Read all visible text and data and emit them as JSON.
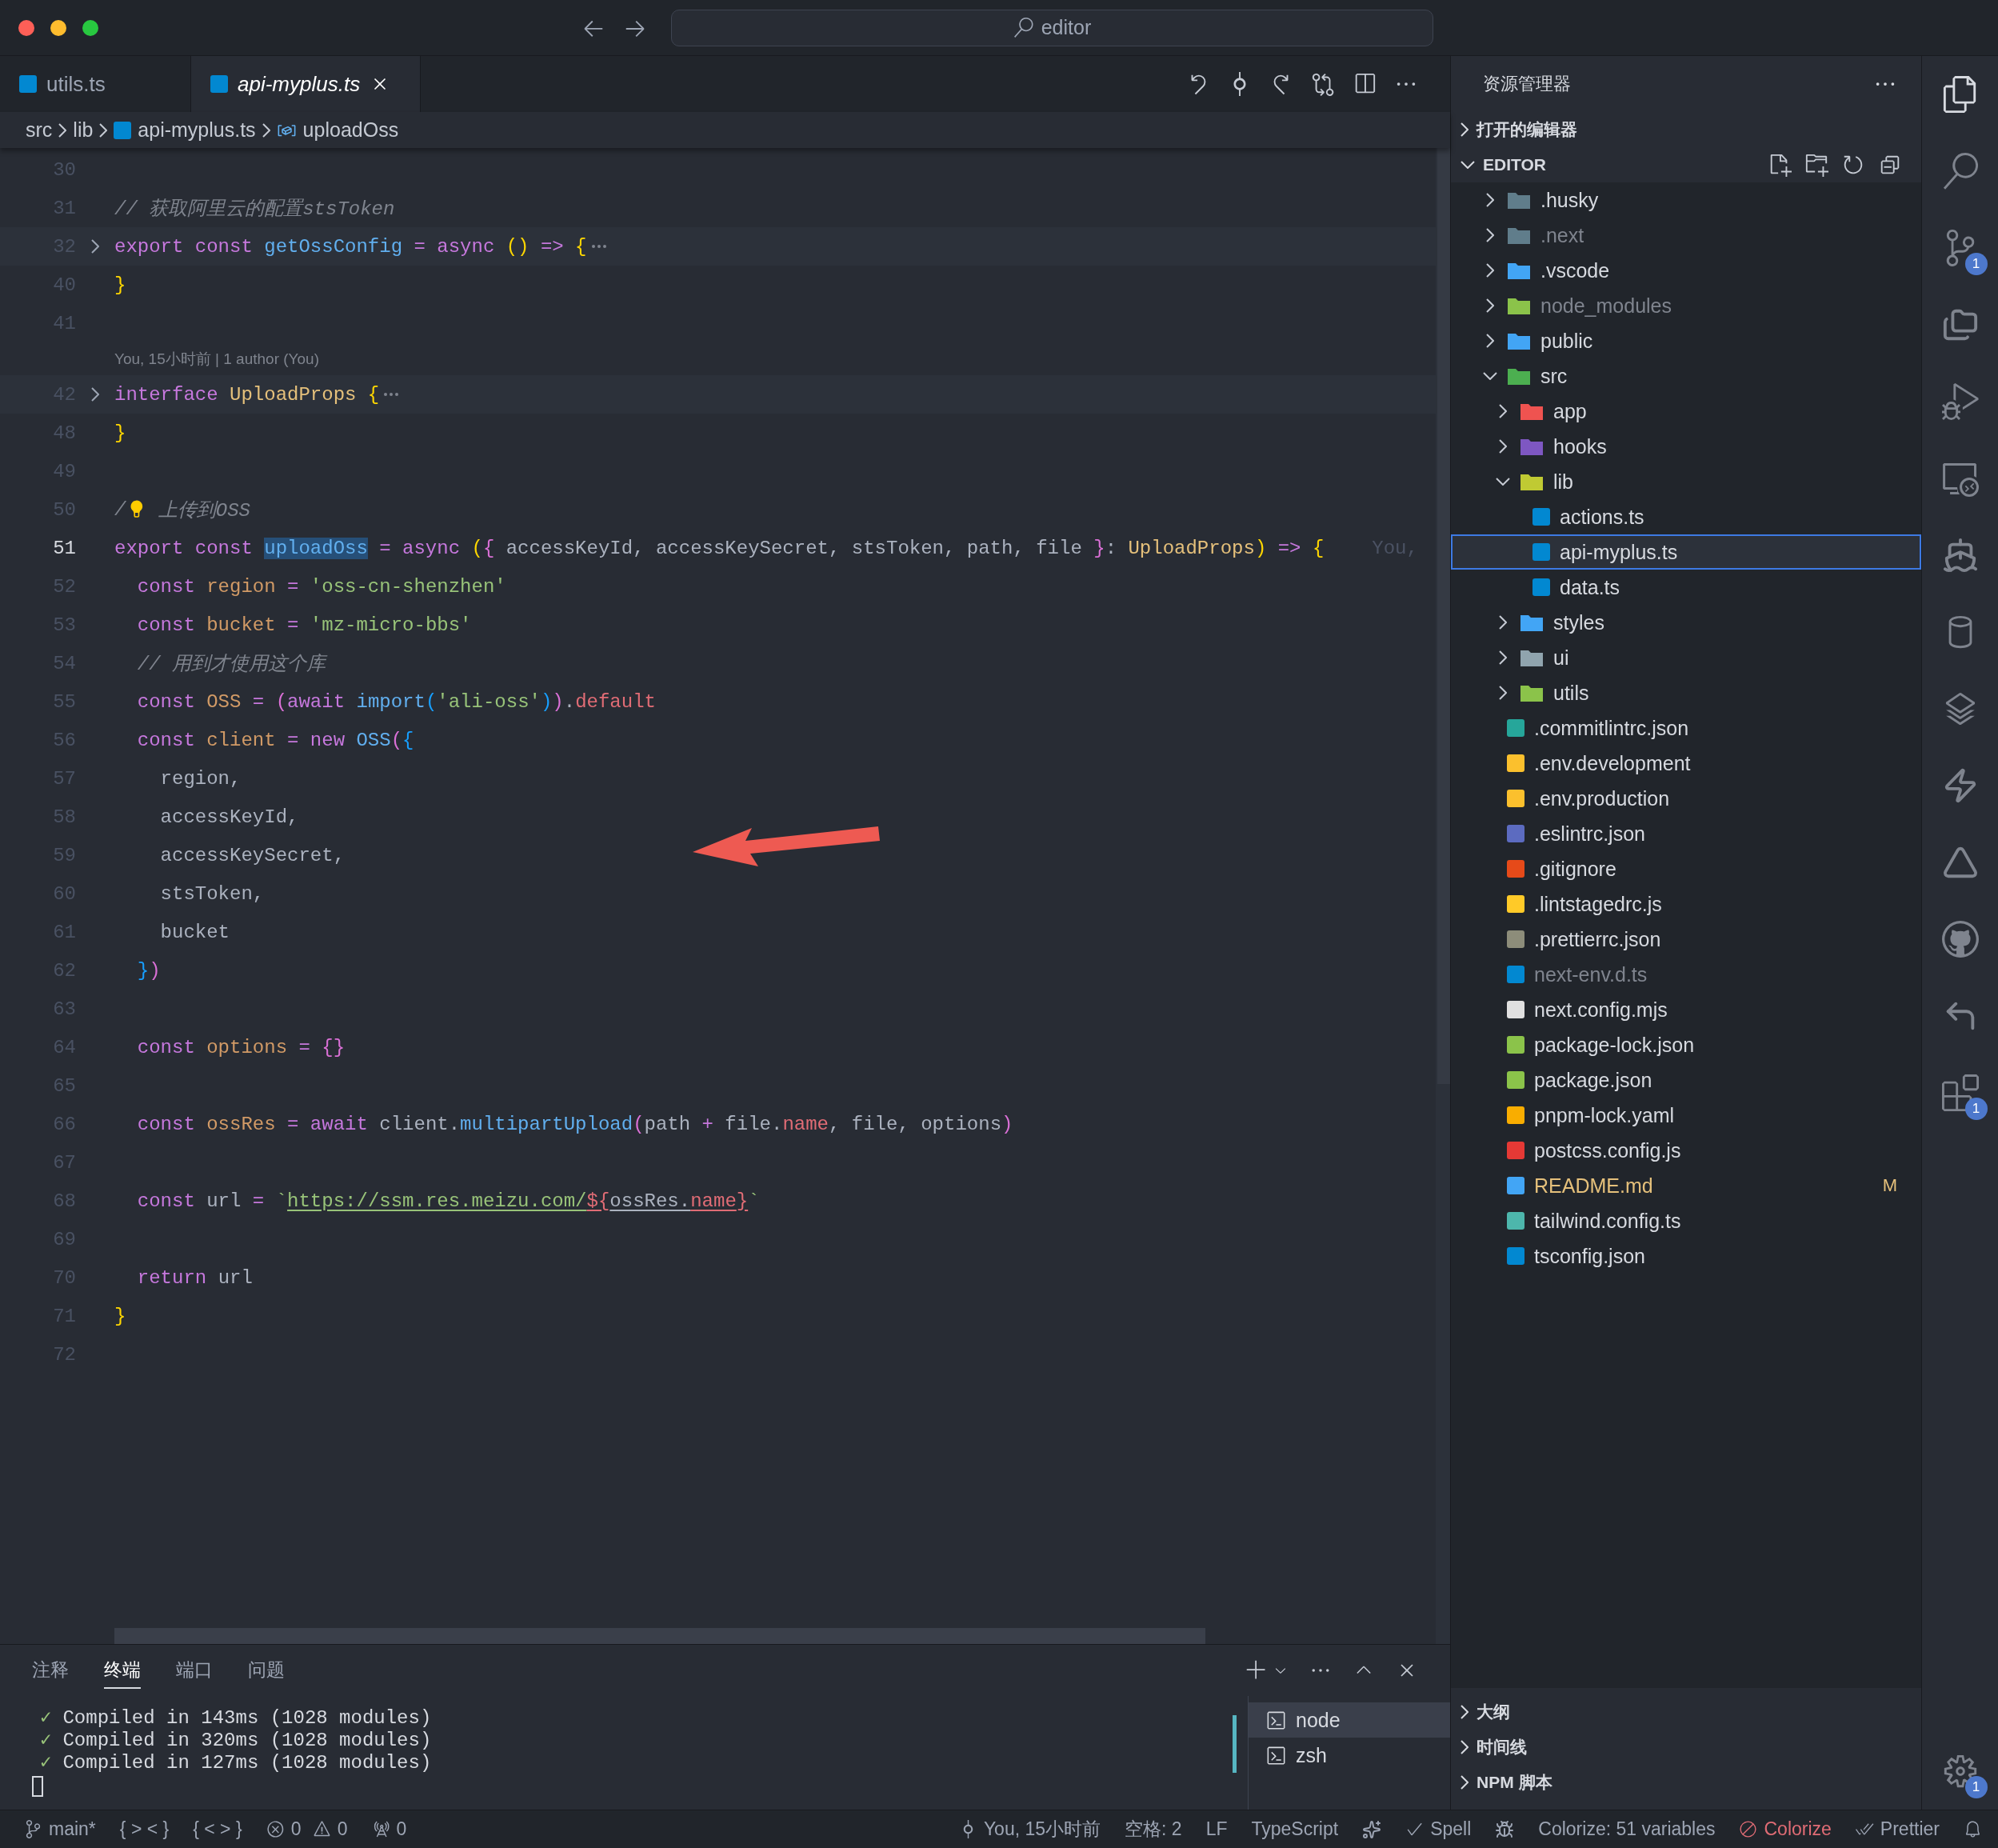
{
  "title_bar": {
    "search": "editor"
  },
  "tabs": [
    {
      "label": "utils.ts",
      "selected": false,
      "preview": false
    },
    {
      "label": "api-myplus.ts",
      "selected": true,
      "preview": true
    }
  ],
  "breadcrumbs": [
    {
      "label": "src",
      "kind": "folder"
    },
    {
      "label": "lib",
      "kind": "folder"
    },
    {
      "label": "api-myplus.ts",
      "kind": "file"
    },
    {
      "label": "uploadOss",
      "kind": "symbol"
    }
  ],
  "editor": {
    "lines": [
      {
        "kind": "code",
        "number": "30",
        "current": false,
        "folded": false
      },
      {
        "kind": "code",
        "number": "31",
        "current": false,
        "folded": false,
        "tokens": [
          {
            "text": "// 获取阿里云的配置stsToken",
            "kind": "comment"
          }
        ]
      },
      {
        "kind": "code",
        "number": "32",
        "current": false,
        "folded": true,
        "tokens": [
          {
            "text": "export const ",
            "kind": "keyword"
          },
          {
            "text": "getOssConfig",
            "kind": "function"
          },
          {
            "text": " = async ",
            "kind": "keyword"
          },
          {
            "text": "()",
            "kind": "bracket1"
          },
          {
            "text": " => ",
            "kind": "keyword"
          },
          {
            "text": "{",
            "kind": "bracket1"
          }
        ]
      },
      {
        "kind": "code",
        "number": "40",
        "current": false,
        "folded": false,
        "tokens": [
          {
            "text": "}",
            "kind": "bracket1"
          }
        ]
      },
      {
        "kind": "code",
        "number": "41",
        "current": false,
        "folded": false
      },
      {
        "kind": "codelens",
        "text": "You, 15小时前 | 1 author (You)"
      },
      {
        "kind": "code",
        "number": "42",
        "current": false,
        "folded": true,
        "tokens": [
          {
            "text": "interface ",
            "kind": "keyword"
          },
          {
            "text": "UploadProps ",
            "kind": "type"
          },
          {
            "text": "{",
            "kind": "bracket1"
          }
        ]
      },
      {
        "kind": "code",
        "number": "48",
        "current": false,
        "folded": false,
        "tokens": [
          {
            "text": "}",
            "kind": "bracket1"
          }
        ]
      },
      {
        "kind": "code",
        "number": "49",
        "current": false,
        "folded": false
      },
      {
        "kind": "code",
        "number": "50",
        "current": false,
        "folded": false,
        "tokens": [
          {
            "text": "/",
            "kind": "comment"
          },
          {
            "kind": "lightbulb"
          },
          {
            "text": " 上传到OSS",
            "kind": "comment"
          }
        ]
      },
      {
        "kind": "code",
        "number": "51",
        "current": true,
        "folded": false,
        "ghost": "You,",
        "tokens": [
          {
            "text": "export const ",
            "kind": "keyword"
          },
          {
            "text": "uploadOss",
            "kind": "function",
            "highlight": true
          },
          {
            "text": " = async ",
            "kind": "keyword"
          },
          {
            "text": "(",
            "kind": "bracket1"
          },
          {
            "text": "{",
            "kind": "bracket2"
          },
          {
            "text": " accessKeyId, accessKeySecret, stsToken, path, file ",
            "kind": "text"
          },
          {
            "text": "}",
            "kind": "bracket2"
          },
          {
            "text": ": ",
            "kind": "text"
          },
          {
            "text": "UploadProps",
            "kind": "type"
          },
          {
            "text": ")",
            "kind": "bracket1"
          },
          {
            "text": " => ",
            "kind": "keyword"
          },
          {
            "text": "{",
            "kind": "bracket1"
          }
        ]
      },
      {
        "kind": "code",
        "number": "52",
        "current": false,
        "folded": false,
        "tokens": [
          {
            "text": "  const ",
            "kind": "keyword"
          },
          {
            "text": "region",
            "kind": "variable"
          },
          {
            "text": " = ",
            "kind": "keyword"
          },
          {
            "text": "'oss-cn-shenzhen'",
            "kind": "string"
          }
        ]
      },
      {
        "kind": "code",
        "number": "53",
        "current": false,
        "folded": false,
        "tokens": [
          {
            "text": "  const ",
            "kind": "keyword"
          },
          {
            "text": "bucket",
            "kind": "variable"
          },
          {
            "text": " = ",
            "kind": "keyword"
          },
          {
            "text": "'mz-micro-bbs'",
            "kind": "string"
          }
        ]
      },
      {
        "kind": "code",
        "number": "54",
        "current": false,
        "folded": false,
        "tokens": [
          {
            "text": "  // 用到才使用这个库",
            "kind": "comment"
          }
        ]
      },
      {
        "kind": "code",
        "number": "55",
        "current": false,
        "folded": false,
        "tokens": [
          {
            "text": "  const ",
            "kind": "keyword"
          },
          {
            "text": "OSS",
            "kind": "variable"
          },
          {
            "text": " = ",
            "kind": "keyword"
          },
          {
            "text": "(",
            "kind": "bracket2"
          },
          {
            "text": "await ",
            "kind": "keyword"
          },
          {
            "text": "import",
            "kind": "function"
          },
          {
            "text": "(",
            "kind": "bracket3"
          },
          {
            "text": "'ali-oss'",
            "kind": "string"
          },
          {
            "text": ")",
            "kind": "bracket3"
          },
          {
            "text": ")",
            "kind": "bracket2"
          },
          {
            "text": ".",
            "kind": "text"
          },
          {
            "text": "default",
            "kind": "property"
          }
        ]
      },
      {
        "kind": "code",
        "number": "56",
        "current": false,
        "folded": false,
        "tokens": [
          {
            "text": "  const ",
            "kind": "keyword"
          },
          {
            "text": "client",
            "kind": "variable"
          },
          {
            "text": " = new ",
            "kind": "keyword"
          },
          {
            "text": "OSS",
            "kind": "function"
          },
          {
            "text": "(",
            "kind": "bracket2"
          },
          {
            "text": "{",
            "kind": "bracket3"
          }
        ]
      },
      {
        "kind": "code",
        "number": "57",
        "current": false,
        "folded": false,
        "tokens": [
          {
            "text": "    region,",
            "kind": "text"
          }
        ]
      },
      {
        "kind": "code",
        "number": "58",
        "current": false,
        "folded": false,
        "tokens": [
          {
            "text": "    accessKeyId,",
            "kind": "text"
          }
        ]
      },
      {
        "kind": "code",
        "number": "59",
        "current": false,
        "folded": false,
        "tokens": [
          {
            "text": "    accessKeySecret,",
            "kind": "text"
          }
        ]
      },
      {
        "kind": "code",
        "number": "60",
        "current": false,
        "folded": false,
        "tokens": [
          {
            "text": "    stsToken,",
            "kind": "text"
          }
        ]
      },
      {
        "kind": "code",
        "number": "61",
        "current": false,
        "folded": false,
        "tokens": [
          {
            "text": "    bucket",
            "kind": "text"
          }
        ]
      },
      {
        "kind": "code",
        "number": "62",
        "current": false,
        "folded": false,
        "tokens": [
          {
            "text": "  }",
            "kind": "bracket3"
          },
          {
            "text": ")",
            "kind": "bracket2"
          }
        ]
      },
      {
        "kind": "code",
        "number": "63",
        "current": false,
        "folded": false
      },
      {
        "kind": "code",
        "number": "64",
        "current": false,
        "folded": false,
        "tokens": [
          {
            "text": "  const ",
            "kind": "keyword"
          },
          {
            "text": "options",
            "kind": "variable"
          },
          {
            "text": " = ",
            "kind": "keyword"
          },
          {
            "text": "{}",
            "kind": "bracket2"
          }
        ]
      },
      {
        "kind": "code",
        "number": "65",
        "current": false,
        "folded": false
      },
      {
        "kind": "code",
        "number": "66",
        "current": false,
        "folded": false,
        "tokens": [
          {
            "text": "  const ",
            "kind": "keyword"
          },
          {
            "text": "ossRes",
            "kind": "variable"
          },
          {
            "text": " = await ",
            "kind": "keyword"
          },
          {
            "text": "client.",
            "kind": "text"
          },
          {
            "text": "multipartUpload",
            "kind": "function"
          },
          {
            "text": "(",
            "kind": "bracket2"
          },
          {
            "text": "path ",
            "kind": "text"
          },
          {
            "text": "+",
            "kind": "keyword"
          },
          {
            "text": " file.",
            "kind": "text"
          },
          {
            "text": "name",
            "kind": "property"
          },
          {
            "text": ", file, options",
            "kind": "text"
          },
          {
            "text": ")",
            "kind": "bracket2"
          }
        ]
      },
      {
        "kind": "code",
        "number": "67",
        "current": false,
        "folded": false
      },
      {
        "kind": "code",
        "number": "68",
        "current": false,
        "folded": false,
        "tokens": [
          {
            "text": "  const ",
            "kind": "keyword"
          },
          {
            "text": "url",
            "kind": "text"
          },
          {
            "text": " = ",
            "kind": "keyword"
          },
          {
            "text": "`",
            "kind": "string"
          },
          {
            "text": "https://ssm.res.meizu.com/",
            "kind": "string",
            "link": true
          },
          {
            "text": "${",
            "kind": "property",
            "link": true
          },
          {
            "text": "ossRes.",
            "kind": "text",
            "link": true
          },
          {
            "text": "name",
            "kind": "property",
            "link": true
          },
          {
            "text": "}",
            "kind": "property",
            "link": true
          },
          {
            "text": "`",
            "kind": "string"
          }
        ]
      },
      {
        "kind": "code",
        "number": "69",
        "current": false,
        "folded": false
      },
      {
        "kind": "code",
        "number": "70",
        "current": false,
        "folded": false,
        "tokens": [
          {
            "text": "  return ",
            "kind": "keyword"
          },
          {
            "text": "url",
            "kind": "text"
          }
        ]
      },
      {
        "kind": "code",
        "number": "71",
        "current": false,
        "folded": false,
        "tokens": [
          {
            "text": "}",
            "kind": "bracket1"
          }
        ]
      },
      {
        "kind": "code",
        "number": "72",
        "current": false,
        "folded": false
      }
    ]
  },
  "panel": {
    "tabs": [
      {
        "label": "注释",
        "selected": false
      },
      {
        "label": "终端",
        "selected": true
      },
      {
        "label": "端口",
        "selected": false
      },
      {
        "label": "问题",
        "selected": false
      }
    ],
    "output": [
      {
        "mark": "✓",
        "text": "Compiled in 143ms (1028 modules)"
      },
      {
        "mark": "✓",
        "text": "Compiled in 320ms (1028 modules)"
      },
      {
        "mark": "✓",
        "text": "Compiled in 127ms (1028 modules)"
      }
    ],
    "terminals": [
      {
        "label": "node",
        "selected": true
      },
      {
        "label": "zsh",
        "selected": false
      }
    ]
  },
  "sidebar": {
    "title": "资源管理器",
    "sections_top": [
      {
        "label": "打开的编辑器",
        "expanded": false
      },
      {
        "label": "EDITOR",
        "expanded": true
      }
    ],
    "tree": [
      {
        "name": ".husky",
        "kind": "folder",
        "expanded": false,
        "selected": false,
        "dimmed": false,
        "modified": false,
        "color": "#607d8b"
      },
      {
        "name": ".next",
        "kind": "folder",
        "expanded": false,
        "selected": false,
        "dimmed": true,
        "modified": false,
        "color": "#607d8b"
      },
      {
        "name": ".vscode",
        "kind": "folder",
        "expanded": false,
        "selected": false,
        "dimmed": false,
        "modified": false,
        "color": "#42a5f5"
      },
      {
        "name": "node_modules",
        "kind": "folder",
        "expanded": false,
        "selected": false,
        "dimmed": true,
        "modified": false,
        "color": "#8bc34a"
      },
      {
        "name": "public",
        "kind": "folder",
        "expanded": false,
        "selected": false,
        "dimmed": false,
        "modified": false,
        "color": "#42a5f5"
      },
      {
        "name": "src",
        "kind": "folder",
        "expanded": true,
        "selected": false,
        "dimmed": false,
        "modified": false,
        "color": "#4caf50",
        "children": [
          {
            "name": "app",
            "kind": "folder",
            "expanded": false,
            "selected": false,
            "dimmed": false,
            "modified": false,
            "color": "#ef5350"
          },
          {
            "name": "hooks",
            "kind": "folder",
            "expanded": false,
            "selected": false,
            "dimmed": false,
            "modified": false,
            "color": "#7e57c2"
          },
          {
            "name": "lib",
            "kind": "folder",
            "expanded": true,
            "selected": false,
            "dimmed": false,
            "modified": false,
            "color": "#c0ca33",
            "children": [
              {
                "name": "actions.ts",
                "kind": "file",
                "selected": false,
                "dimmed": false,
                "modified": false,
                "color": "#0288d1"
              },
              {
                "name": "api-myplus.ts",
                "kind": "file",
                "selected": true,
                "dimmed": false,
                "modified": false,
                "color": "#0288d1"
              },
              {
                "name": "data.ts",
                "kind": "file",
                "selected": false,
                "dimmed": false,
                "modified": false,
                "color": "#0288d1"
              }
            ]
          },
          {
            "name": "styles",
            "kind": "folder",
            "expanded": false,
            "selected": false,
            "dimmed": false,
            "modified": false,
            "color": "#42a5f5"
          },
          {
            "name": "ui",
            "kind": "folder",
            "expanded": false,
            "selected": false,
            "dimmed": false,
            "modified": false,
            "color": "#90a4ae"
          },
          {
            "name": "utils",
            "kind": "folder",
            "expanded": false,
            "selected": false,
            "dimmed": false,
            "modified": false,
            "color": "#8bc34a"
          }
        ]
      },
      {
        "name": ".commitlintrc.json",
        "kind": "file",
        "selected": false,
        "dimmed": false,
        "modified": false,
        "color": "#26a69a"
      },
      {
        "name": ".env.development",
        "kind": "file",
        "selected": false,
        "dimmed": false,
        "modified": false,
        "color": "#fbc02d"
      },
      {
        "name": ".env.production",
        "kind": "file",
        "selected": false,
        "dimmed": false,
        "modified": false,
        "color": "#fbc02d"
      },
      {
        "name": ".eslintrc.json",
        "kind": "file",
        "selected": false,
        "dimmed": false,
        "modified": false,
        "color": "#5c6bc0"
      },
      {
        "name": ".gitignore",
        "kind": "file",
        "selected": false,
        "dimmed": false,
        "modified": false,
        "color": "#e64a19"
      },
      {
        "name": ".lintstagedrc.js",
        "kind": "file",
        "selected": false,
        "dimmed": false,
        "modified": false,
        "color": "#ffca28"
      },
      {
        "name": ".prettierrc.json",
        "kind": "file",
        "selected": false,
        "dimmed": false,
        "modified": false,
        "color": "#8d8d7a"
      },
      {
        "name": "next-env.d.ts",
        "kind": "file",
        "selected": false,
        "dimmed": true,
        "modified": false,
        "color": "#0288d1"
      },
      {
        "name": "next.config.mjs",
        "kind": "file",
        "selected": false,
        "dimmed": false,
        "modified": false,
        "color": "#e0e0e0"
      },
      {
        "name": "package-lock.json",
        "kind": "file",
        "selected": false,
        "dimmed": false,
        "modified": false,
        "color": "#8bc34a"
      },
      {
        "name": "package.json",
        "kind": "file",
        "selected": false,
        "dimmed": false,
        "modified": false,
        "color": "#8bc34a"
      },
      {
        "name": "pnpm-lock.yaml",
        "kind": "file",
        "selected": false,
        "dimmed": false,
        "modified": false,
        "color": "#f9ad00"
      },
      {
        "name": "postcss.config.js",
        "kind": "file",
        "selected": false,
        "dimmed": false,
        "modified": false,
        "color": "#e53935"
      },
      {
        "name": "README.md",
        "kind": "file",
        "selected": false,
        "dimmed": false,
        "modified": true,
        "badge": "M",
        "color": "#42a5f5"
      },
      {
        "name": "tailwind.config.ts",
        "kind": "file",
        "selected": false,
        "dimmed": false,
        "modified": false,
        "color": "#4db6ac"
      },
      {
        "name": "tsconfig.json",
        "kind": "file",
        "selected": false,
        "dimmed": false,
        "modified": false,
        "color": "#0288d1"
      }
    ],
    "sections_bottom": [
      {
        "label": "大纲",
        "expanded": false
      },
      {
        "label": "时间线",
        "expanded": false
      },
      {
        "label": "NPM 脚本",
        "expanded": false
      }
    ]
  },
  "activity_bar": {
    "top": [
      {
        "kind": "files",
        "selected": true
      },
      {
        "kind": "search",
        "selected": false
      },
      {
        "kind": "source-control",
        "selected": false,
        "badge": "1"
      },
      {
        "kind": "folders",
        "selected": false
      },
      {
        "kind": "debug",
        "selected": false
      },
      {
        "kind": "remote",
        "selected": false
      },
      {
        "kind": "ship",
        "selected": false
      },
      {
        "kind": "database",
        "selected": false
      },
      {
        "kind": "layers",
        "selected": false
      },
      {
        "kind": "lightning",
        "selected": false
      },
      {
        "kind": "triangle",
        "selected": false
      },
      {
        "kind": "github",
        "selected": false
      },
      {
        "kind": "arrow",
        "selected": false
      },
      {
        "kind": "extensions",
        "selected": false,
        "badge": "1"
      }
    ],
    "settings_badge": "1"
  },
  "status_bar": {
    "left": [
      {
        "kind": "branch",
        "text": "main*"
      },
      {
        "kind": "plain",
        "text": "{ > < }"
      },
      {
        "kind": "plain",
        "text": "{ < > }"
      },
      {
        "kind": "problems",
        "errors": "0",
        "warnings": "0"
      },
      {
        "kind": "ports",
        "text": "0"
      }
    ],
    "right": [
      {
        "kind": "blame",
        "text": "You, 15小时前"
      },
      {
        "kind": "plain",
        "text": "空格: 2"
      },
      {
        "kind": "plain",
        "text": "LF"
      },
      {
        "kind": "plain",
        "text": "TypeScript"
      },
      {
        "kind": "sparkle"
      },
      {
        "kind": "check",
        "text": "Spell"
      },
      {
        "kind": "bug"
      },
      {
        "kind": "plain",
        "text": "Colorize: 51 variables"
      },
      {
        "kind": "blocked",
        "text": "Colorize"
      },
      {
        "kind": "check-all",
        "text": "Prettier"
      },
      {
        "kind": "bell"
      }
    ]
  }
}
